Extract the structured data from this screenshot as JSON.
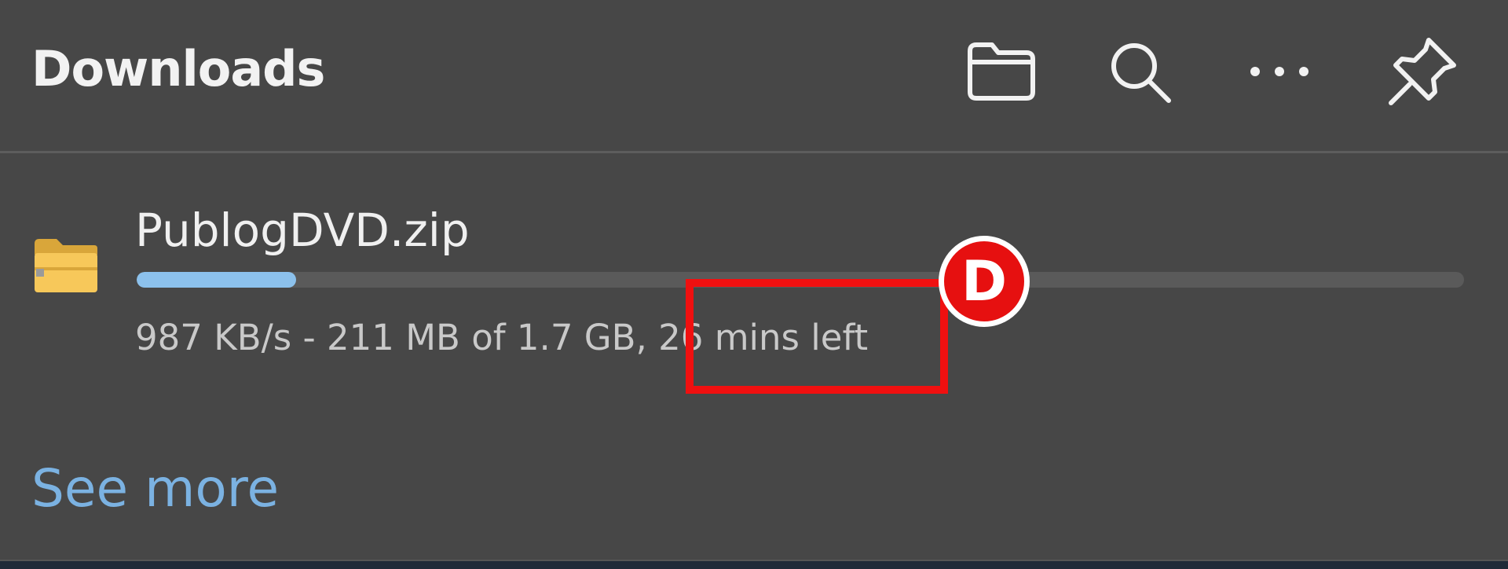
{
  "header": {
    "title": "Downloads",
    "tools": [
      {
        "icon": "folder-icon"
      },
      {
        "icon": "search-icon"
      },
      {
        "icon": "more-icon"
      },
      {
        "icon": "pin-icon"
      }
    ]
  },
  "download": {
    "filename": "PublogDVD.zip",
    "file_icon": "zip-folder-icon",
    "progress_fraction": 0.12,
    "status_text": "987 KB/s - 211 MB of 1.7 GB, 26 mins left"
  },
  "annotation": {
    "marker_label": "D"
  },
  "footer": {
    "see_more_label": "See more"
  },
  "colors": {
    "background": "#474747",
    "progress": "#8cc1ec",
    "link": "#7bb2e2",
    "annotation": "#f01010"
  }
}
